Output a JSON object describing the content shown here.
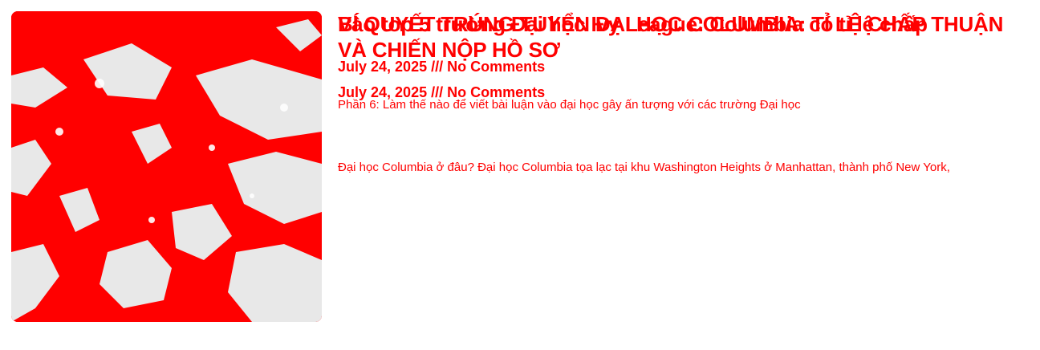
{
  "posts": [
    {
      "title": "Vào top 5 trường Đại học Ivy League: Columbia có tỉ lệ chấp",
      "meta": "July 24, 2025 /// No Comments",
      "excerpt": "Phần 6: Làm thế nào để viết bài luận vào đại học gây ấn tượng với các trường Đại học"
    },
    {
      "title": "BÍ QUYẾT TRÚNG TUYỂN ĐẠI HỌC COLUMBIA: TỈ LỆ CHẤP THUẬN VÀ CHIẾN NỘP HỒ SƠ",
      "meta": "July 24, 2025 /// No Comments",
      "excerpt": "Đại học Columbia ở đâu? Đại học Columbia tọa lạc tại khu Washington Heights ở Manhattan, thành phố New York,"
    }
  ],
  "colors": {
    "accent": "#ff0000",
    "image_light": "#e8e8e8"
  }
}
